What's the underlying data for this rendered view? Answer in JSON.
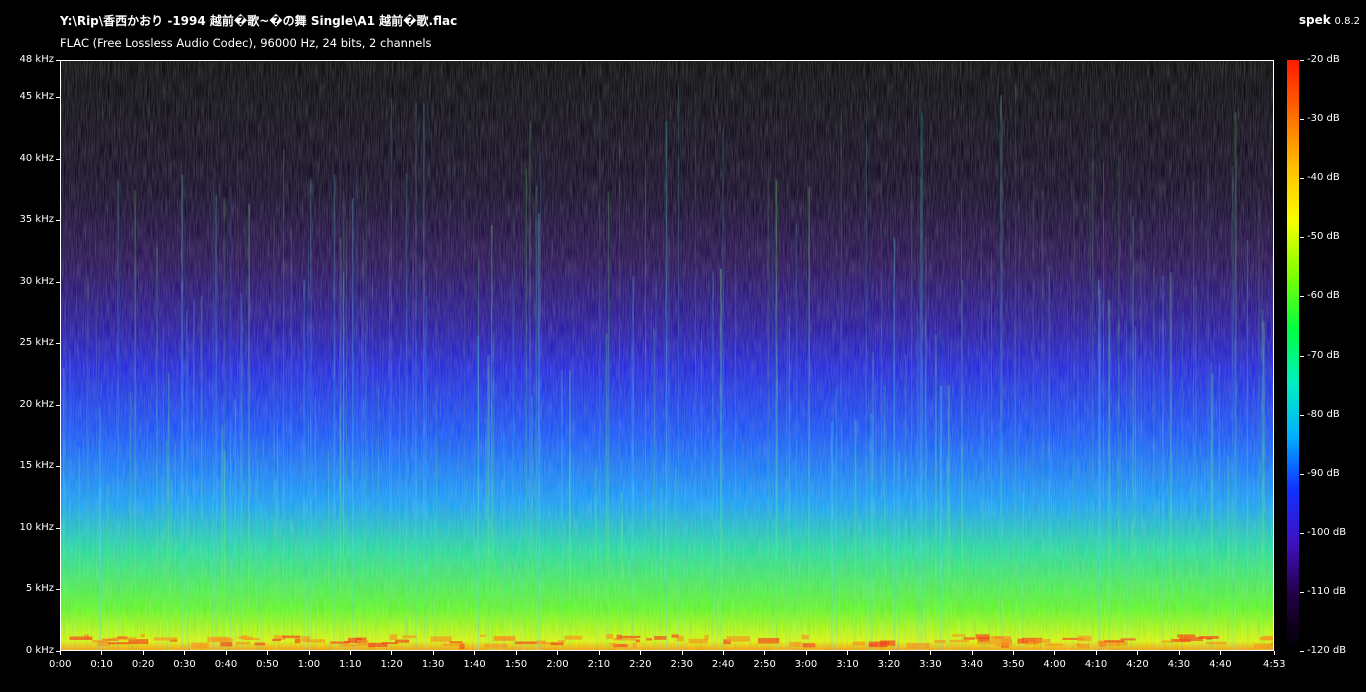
{
  "header": {
    "file_title": "Y:\\Rip\\香西かおり -1994 越前�歌~�の舞 Single\\A1 越前�歌.flac",
    "format_info": "FLAC (Free Lossless Audio Codec), 96000 Hz, 24 bits, 2 channels"
  },
  "brand": {
    "name": "spek",
    "version": "0.8.2"
  },
  "frequency_axis": {
    "unit": "kHz",
    "max_khz": 48,
    "ticks": [
      "0 kHz",
      "5 kHz",
      "10 kHz",
      "15 kHz",
      "20 kHz",
      "25 kHz",
      "30 kHz",
      "35 kHz",
      "40 kHz",
      "45 kHz",
      "48 kHz"
    ]
  },
  "time_axis": {
    "total_seconds": 293,
    "ticks": [
      "0:00",
      "0:10",
      "0:20",
      "0:30",
      "0:40",
      "0:50",
      "1:00",
      "1:10",
      "1:20",
      "1:30",
      "1:40",
      "1:50",
      "2:00",
      "2:10",
      "2:20",
      "2:30",
      "2:40",
      "2:50",
      "3:00",
      "3:10",
      "3:20",
      "3:30",
      "3:40",
      "3:50",
      "4:00",
      "4:10",
      "4:20",
      "4:30",
      "4:40",
      "4:53"
    ]
  },
  "db_scale": {
    "ticks": [
      "-20 dB",
      "-30 dB",
      "-40 dB",
      "-50 dB",
      "-60 dB",
      "-70 dB",
      "-80 dB",
      "-90 dB",
      "-100 dB",
      "-110 dB",
      "-120 dB"
    ],
    "colors": [
      "#ff1a00",
      "#ff6a00",
      "#ffc000",
      "#f8ff00",
      "#80ff00",
      "#00ff40",
      "#00f0c0",
      "#00b0ff",
      "#1030ff",
      "#4010c0",
      "#200040",
      "#000000"
    ]
  }
}
